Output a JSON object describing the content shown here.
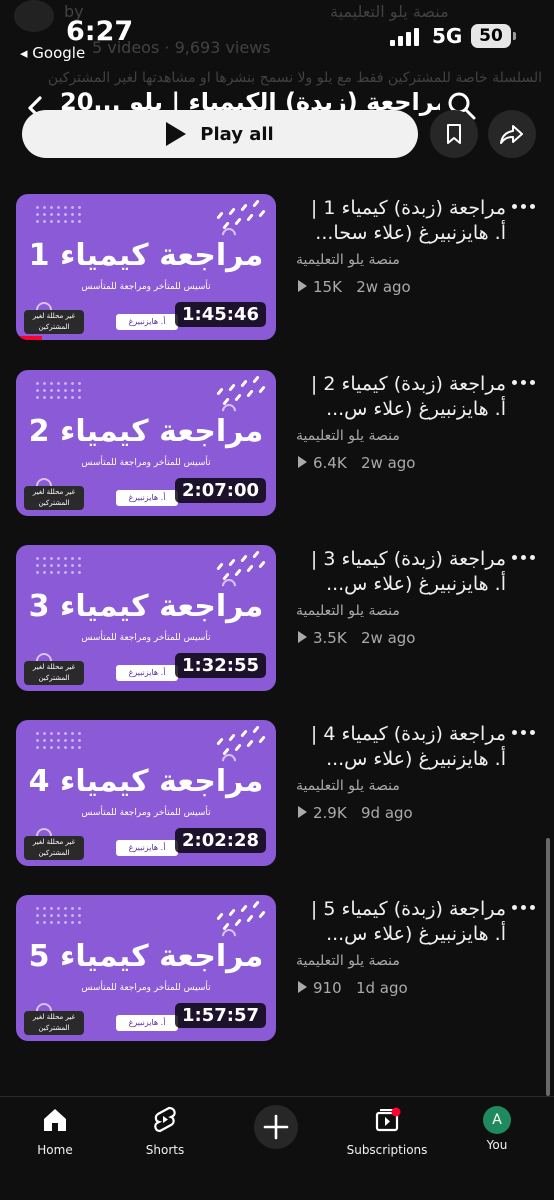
{
  "status_bar": {
    "time": "6:27",
    "back_app": "◂ Google",
    "network": "5G",
    "battery": "50"
  },
  "header_ghost": {
    "by": "by",
    "channel": "منصة يلو التعليمية",
    "stats": "5 videos · 9,693 views",
    "description": "السلسلة خاصة للمشتركين فقط مع يلو ولا نسمح بنشرها او مشاهدتها لغير المشتركين"
  },
  "playlist": {
    "title": "مراجعة (زبدة) الكيمياء | يلو ...20",
    "play_all_label": "Play all"
  },
  "videos": [
    {
      "title": "مراجعة (زبدة) كيمياء 1 | أ. هايزنبيرغ (علاء سحا...",
      "channel": "منصة يلو التعليمية",
      "views": "15K",
      "age": "2w ago",
      "duration": "1:45:46",
      "thumb_text": "مراجعة كيمياء 1",
      "watched_fraction": 0.1
    },
    {
      "title": "مراجعة (زبدة) كيمياء 2 | أ. هايزنبيرغ (علاء س...",
      "channel": "منصة يلو التعليمية",
      "views": "6.4K",
      "age": "2w ago",
      "duration": "2:07:00",
      "thumb_text": "مراجعة كيمياء 2",
      "watched_fraction": 0
    },
    {
      "title": "مراجعة (زبدة) كيمياء 3 | أ. هايزنبيرغ (علاء س...",
      "channel": "منصة يلو التعليمية",
      "views": "3.5K",
      "age": "2w ago",
      "duration": "1:32:55",
      "thumb_text": "مراجعة كيمياء 3",
      "watched_fraction": 0
    },
    {
      "title": "مراجعة (زبدة) كيمياء 4 | أ. هايزنبيرغ (علاء س...",
      "channel": "منصة يلو التعليمية",
      "views": "2.9K",
      "age": "9d ago",
      "duration": "2:02:28",
      "thumb_text": "مراجعة كيمياء 4",
      "watched_fraction": 0
    },
    {
      "title": "مراجعة (زبدة) كيمياء 5 | أ. هايزنبيرغ (علاء س...",
      "channel": "منصة يلو التعليمية",
      "views": "910",
      "age": "1d ago",
      "duration": "1:57:57",
      "thumb_text": "مراجعة كيمياء 5",
      "watched_fraction": 0
    }
  ],
  "thumb_labels": {
    "subtitle": "تأسيس للمتأخر ومراجعة للمتأسس",
    "teacher": "أ. هايزنبيرغ",
    "badge": "غير محللة لغير المشتركين"
  },
  "bottom_nav": {
    "home": "Home",
    "shorts": "Shorts",
    "subscriptions": "Subscriptions",
    "you": "You",
    "avatar_letter": "A"
  },
  "colors": {
    "background": "#0f0f0f",
    "thumbnail_purple": "#8b5ad6",
    "notification_red": "#ff0033",
    "avatar_green": "#1f8a5e"
  },
  "icons": [
    "back-arrow-icon",
    "search-icon",
    "save-playlist-icon",
    "share-icon",
    "more-vert-icon",
    "home-icon",
    "shorts-icon",
    "add-icon",
    "subscriptions-icon"
  ]
}
